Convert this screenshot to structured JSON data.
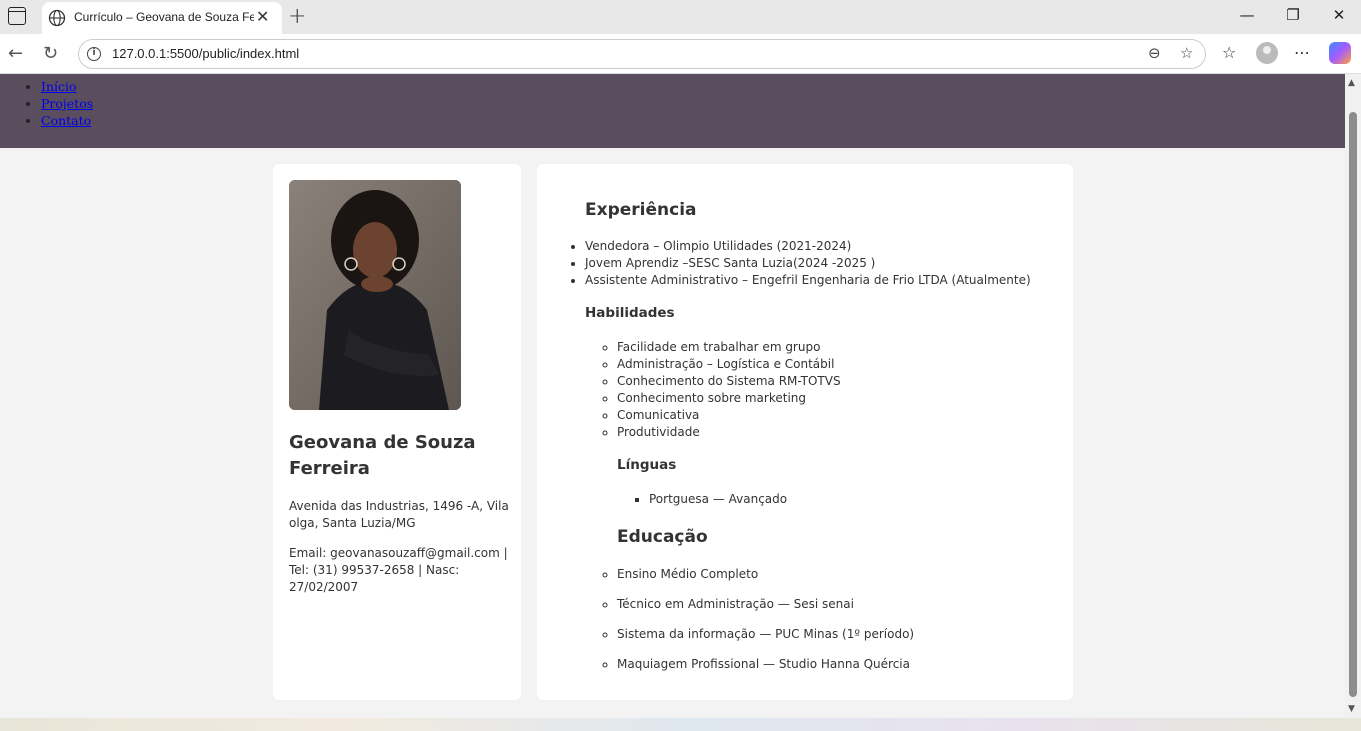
{
  "browser": {
    "tab_title": "Currículo – Geovana de Souza Ferreira",
    "url": "127.0.0.1:5500/public/index.html"
  },
  "site_nav": {
    "items": [
      "Início",
      "Projetos",
      "Contato"
    ]
  },
  "profile": {
    "name": "Geovana de Souza Ferreira",
    "address": "Avenida das Industrias, 1496 -A, Vila olga, Santa Luzia/MG",
    "contact": "Email: geovanasouzaff@gmail.com | Tel: (31) 99537-2658 | Nasc: 27/02/2007"
  },
  "experience": {
    "title": "Experiência",
    "items": [
      "Vendedora – Olimpio Utilidades (2021-2024)",
      "Jovem Aprendiz –SESC Santa Luzia(2024 -2025 )",
      "Assistente Administrativo – Engefril Engenharia de Frio LTDA (Atualmente)"
    ]
  },
  "skills": {
    "title": "Habilidades",
    "items": [
      "Facilidade em trabalhar em grupo",
      "Administração – Logística e Contábil",
      "Conhecimento do Sistema RM-TOTVS",
      "Conhecimento sobre marketing",
      "Comunicativa",
      "Produtividade"
    ]
  },
  "languages": {
    "title": "Línguas",
    "items": [
      "Portguesa — Avançado"
    ]
  },
  "education": {
    "title": "Educação",
    "items": [
      "Ensino Médio Completo",
      "Técnico em Administração — Sesi senai",
      "Sistema da informação — PUC Minas (1º período)",
      "Maquiagem Profissional — Studio Hanna Quércia"
    ]
  },
  "colors": {
    "header_bg": "#5a4d5d",
    "page_bg": "#f3f3f3",
    "card_bg": "#ffffff",
    "link": "#0000ee"
  },
  "icons": [
    "tab-list-icon",
    "globe-icon",
    "close-icon",
    "plus-icon",
    "minimize-icon",
    "restore-icon",
    "back-icon",
    "refresh-icon",
    "info-icon",
    "zoom-out-icon",
    "star-icon",
    "favorites-icon",
    "profile-icon",
    "more-icon",
    "copilot-icon"
  ]
}
